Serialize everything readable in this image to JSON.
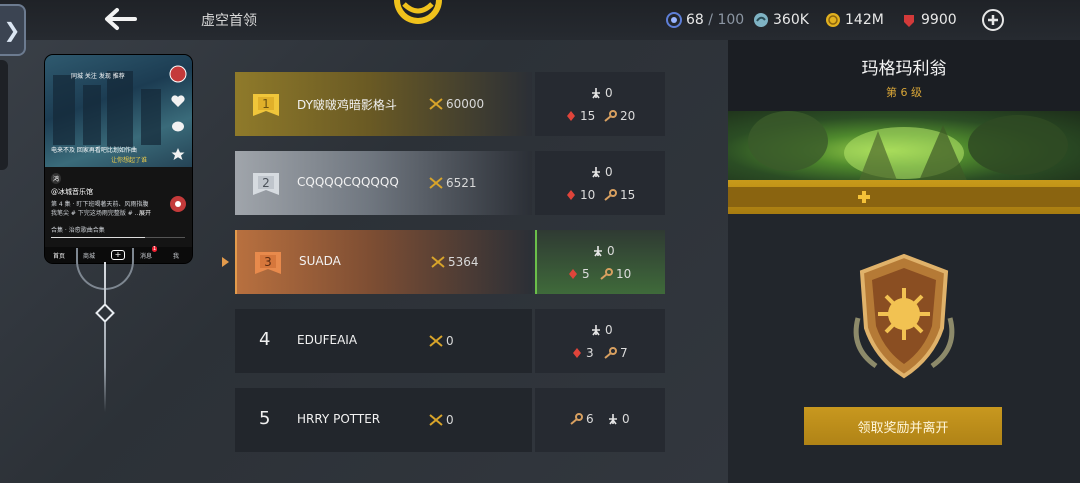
{
  "header": {
    "title": "虚空首领",
    "resources": {
      "energy_current": "68",
      "energy_sep": " / ",
      "energy_max": "100",
      "silver": "360K",
      "gold": "142M",
      "gems": "9900"
    }
  },
  "phone": {
    "top_tabs": "同城  关注  发现  推荐",
    "caption1": "电来不及 回家再看吧比划如作曲",
    "caption2": "让你想起了谁",
    "channel_badge": "鸿",
    "channel": "@冰城音乐馆",
    "desc1": "第 4 集 · 盯下班喝著天前、风雨指腹",
    "desc2": "我笔尖 # 下完这场雨完整版 # ...",
    "desc_more": "展开",
    "collection": "合集 · 治愈歌曲合集",
    "nav": [
      "首页",
      "商城",
      "消息",
      "我"
    ],
    "msg_badge": "1"
  },
  "ranking": [
    {
      "rank": "1",
      "name": "DY啵啵鸡暗影格斗",
      "score": "60000",
      "s1": "0",
      "s2": "15",
      "s3": "20"
    },
    {
      "rank": "2",
      "name": "CQQQQCQQQQQ",
      "score": "6521",
      "s1": "0",
      "s2": "10",
      "s3": "15"
    },
    {
      "rank": "3",
      "name": "SUADA",
      "score": "5364",
      "s1": "0",
      "s2": "5",
      "s3": "10"
    },
    {
      "rank": "4",
      "name": "EDUFEAIA",
      "score": "0",
      "s1": "0",
      "s2": "3",
      "s3": "7"
    },
    {
      "rank": "5",
      "name": "HRRY POTTER",
      "score": "0",
      "s1": "6",
      "s2": "0"
    }
  ],
  "boss": {
    "name": "玛格玛利翁",
    "level": "第 6 级"
  },
  "claim_button": "领取奖励并离开",
  "colors": {
    "gold": "#c89a1a",
    "rank1": "#8a7628",
    "rank2": "#9aa0a8",
    "rank3": "#b26a3a",
    "highlight_green": "#3f6a3a"
  }
}
